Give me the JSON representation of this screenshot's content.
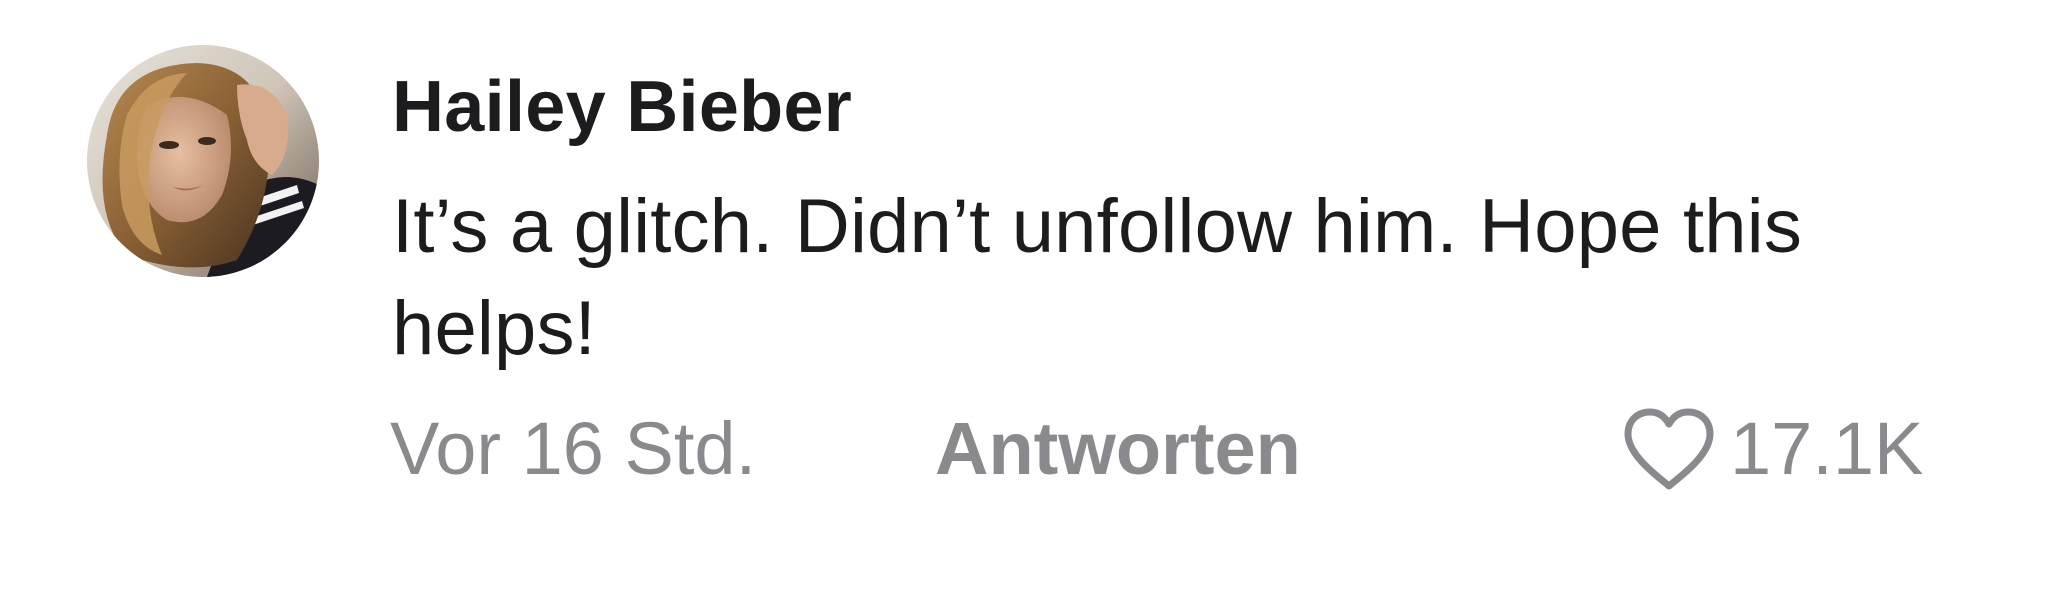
{
  "comment": {
    "avatar_icon": "profile-photo",
    "username": "Hailey Bieber",
    "text": "It’s a glitch. Didn’t unfollow him. Hope this helps!",
    "timestamp": "Vor 16 Std.",
    "reply_label": "Antworten",
    "like_icon": "heart-outline-icon",
    "like_count": "17.1K"
  },
  "colors": {
    "text_primary": "#1c1c1e",
    "text_secondary": "#8a8a8e",
    "background": "#ffffff"
  }
}
